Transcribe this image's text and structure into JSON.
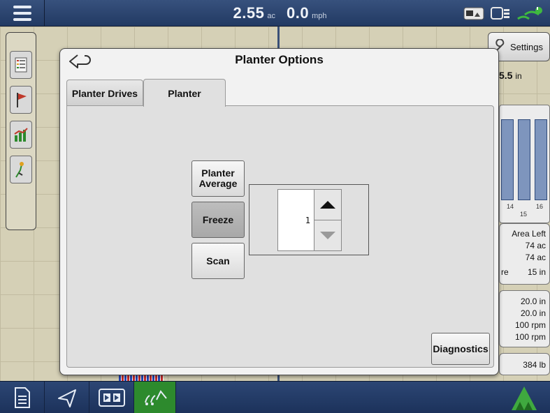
{
  "top_bar": {
    "area_value": "2.55",
    "area_unit": "ac",
    "speed_value": "0.0",
    "speed_unit": "mph",
    "icons": [
      "menu-icon",
      "camera-icon",
      "vehicle-icon",
      "gps-signal-icon"
    ]
  },
  "left_tools": [
    "legend-icon",
    "flag-icon",
    "chart-icon",
    "guidance-icon"
  ],
  "right_panel": {
    "settings_label": "Settings",
    "top_value": "5.5",
    "top_unit": "in",
    "bar_labels": [
      "14",
      "15",
      "16"
    ],
    "area_left_label": "Area Left",
    "area_left_values": [
      "74 ac",
      "74 ac"
    ],
    "re_label": "re",
    "re_value": "15 in",
    "rate_values": [
      "20.0 in",
      "20.0 in",
      "100 rpm",
      "100 rpm"
    ],
    "weight_value": "384 lb"
  },
  "bottom_bar": {
    "icons": [
      "document-icon",
      "navigation-icon",
      "split-view-icon",
      "planter-icon",
      "home-logo-icon"
    ]
  },
  "dialog": {
    "title": "Planter Options",
    "tabs": [
      {
        "label": "Planter Drives",
        "active": false
      },
      {
        "label": "Planter",
        "active": true
      }
    ],
    "options": {
      "average_label": "Planter Average",
      "freeze_label": "Freeze",
      "scan_label": "Scan"
    },
    "stepper_value": "1",
    "diagnostics_label": "Diagnostics"
  },
  "colors": {
    "bar_navy": "#223a63",
    "accent_green": "#2d8a2d",
    "dialog_bg": "#e0e0e0"
  }
}
